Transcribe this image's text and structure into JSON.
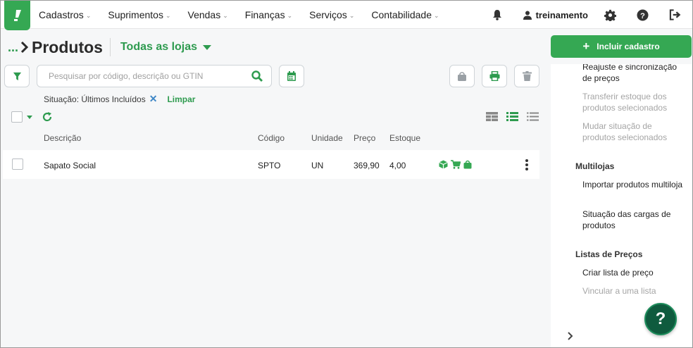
{
  "nav": {
    "items": [
      {
        "label": "Cadastros"
      },
      {
        "label": "Suprimentos"
      },
      {
        "label": "Vendas"
      },
      {
        "label": "Finanças"
      },
      {
        "label": "Serviços"
      },
      {
        "label": "Contabilidade"
      }
    ],
    "user": "treinamento"
  },
  "page": {
    "breadcrumb": "...",
    "title": "Produtos",
    "store": "Todas as lojas"
  },
  "search": {
    "placeholder": "Pesquisar por código, descrição ou GTIN"
  },
  "filter": {
    "text": "Situação: Últimos Incluídos",
    "clear_label": "Limpar"
  },
  "table": {
    "columns": [
      "Descrição",
      "Código",
      "Unidade",
      "Preço",
      "Estoque"
    ],
    "rows": [
      {
        "descricao": "Sapato Social",
        "codigo": "SPTO",
        "unidade": "UN",
        "preco": "369,90",
        "estoque": "4,00"
      }
    ]
  },
  "panel": {
    "include_label": "Incluir cadastro",
    "items": [
      {
        "label": "Reajuste e sincronização de preços",
        "enabled": true
      },
      {
        "label": "Transferir estoque dos produtos selecionados",
        "enabled": false
      },
      {
        "label": "Mudar situação de produtos selecionados",
        "enabled": false
      }
    ],
    "sections": [
      {
        "title": "Multilojas",
        "items": [
          {
            "label": "Importar produtos multiloja",
            "enabled": true
          },
          {
            "label": "Situação das cargas de produtos",
            "enabled": true
          }
        ]
      },
      {
        "title": "Listas de Preços",
        "items": [
          {
            "label": "Criar lista de preço",
            "enabled": true
          },
          {
            "label": "Vincular a uma lista",
            "enabled": false
          }
        ]
      }
    ]
  },
  "help_label": "?",
  "colors": {
    "brand_green": "#35a853",
    "link_green": "#2e9b4f",
    "fab_dark": "#0f5b3e",
    "clear_x_blue": "#3f87c6"
  },
  "icons": [
    "bell-icon",
    "user-icon",
    "gear-icon",
    "help-circle-icon",
    "logout-icon",
    "filter-icon",
    "search-icon",
    "calendar-icon",
    "bag-icon",
    "printer-icon",
    "trash-icon",
    "refresh-icon",
    "table-view-icon",
    "list-view-icon",
    "compact-list-icon",
    "box-icon",
    "cart-icon",
    "bag-green-icon",
    "kebab-icon",
    "chevron-right-icon"
  ]
}
